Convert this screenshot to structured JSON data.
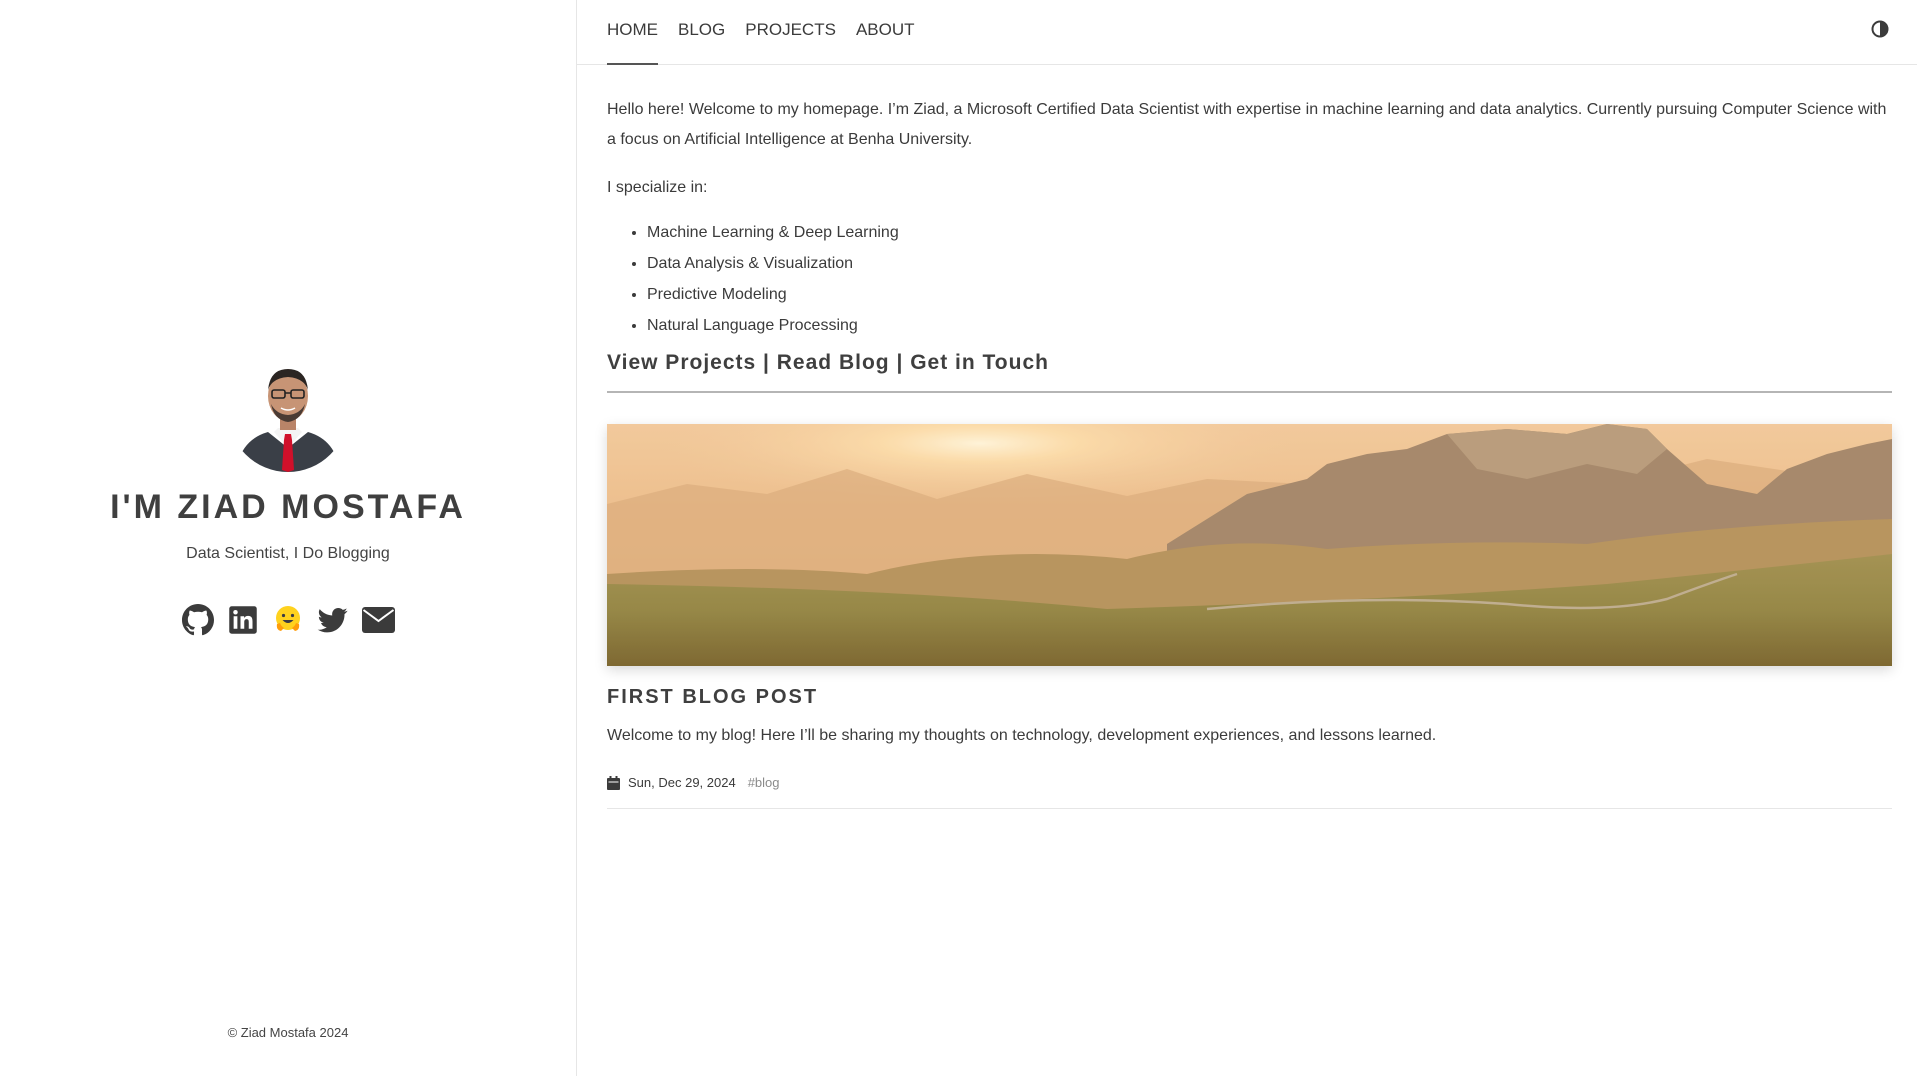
{
  "sidebar": {
    "name": "I'M ZIAD MOSTAFA",
    "subtitle": "Data Scientist, I Do Blogging",
    "socials": [
      {
        "icon": "github-icon"
      },
      {
        "icon": "linkedin-icon"
      },
      {
        "icon": "huggingface-icon"
      },
      {
        "icon": "twitter-icon"
      },
      {
        "icon": "envelope-icon"
      }
    ],
    "copyright": "© Ziad Mostafa 2024"
  },
  "nav": {
    "items": [
      {
        "label": "HOME",
        "active": true
      },
      {
        "label": "BLOG",
        "active": false
      },
      {
        "label": "PROJECTS",
        "active": false
      },
      {
        "label": "ABOUT",
        "active": false
      }
    ],
    "theme_icon": "contrast-icon"
  },
  "content": {
    "intro": "Hello here! Welcome to my homepage. I’m Ziad, a Microsoft Certified Data Scientist with expertise in machine learning and data analytics. Currently pursuing Computer Science with a focus on Artificial Intelligence at Benha University.",
    "specialize_label": "I specialize in:",
    "specialties": [
      "Machine Learning & Deep Learning",
      "Data Analysis & Visualization",
      "Predictive Modeling",
      "Natural Language Processing"
    ],
    "cta": {
      "projects": "View Projects",
      "blog": "Read Blog",
      "contact": "Get in Touch",
      "separator": "|"
    }
  },
  "post": {
    "title": "FIRST BLOG POST",
    "excerpt": "Welcome to my blog! Here I’ll be sharing my thoughts on technology, development experiences, and lessons learned.",
    "date": "Sun, Dec 29, 2024",
    "tag": "#blog",
    "calendar_icon": "calendar-icon"
  },
  "colors": {
    "accent_red": "#d0102a",
    "emoji_yellow": "#ffd21e",
    "text": "#3b3b3b",
    "muted": "#8a8a8a"
  }
}
